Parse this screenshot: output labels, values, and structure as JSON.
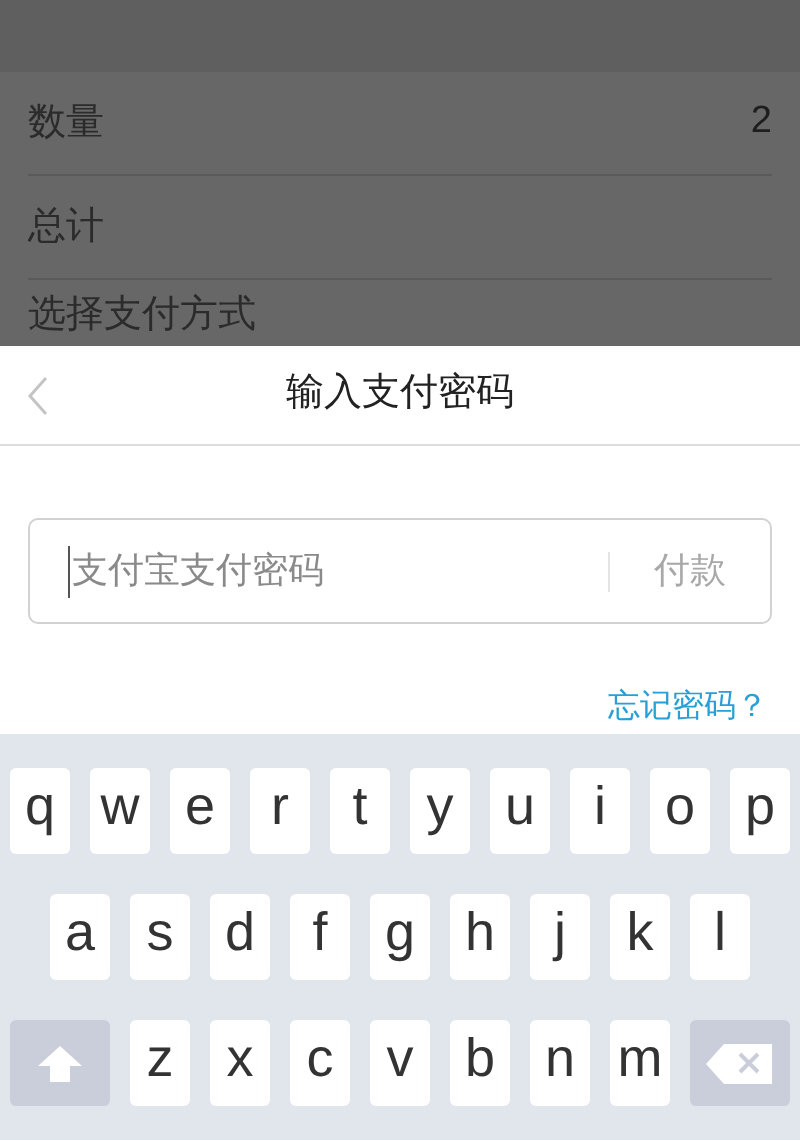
{
  "background_page": {
    "rows": [
      {
        "label": "数量",
        "value": "2"
      },
      {
        "label": "总计"
      },
      {
        "label": "选择支付方式"
      }
    ]
  },
  "sheet": {
    "title": "输入支付密码",
    "password_field": {
      "placeholder": "支付宝支付密码"
    },
    "pay_button": {
      "label": "付款",
      "disabled": true
    },
    "forgot_link": "忘记密码？"
  },
  "keyboard": {
    "rows": [
      [
        {
          "kind": "letter",
          "label": "q"
        },
        {
          "kind": "letter",
          "label": "w"
        },
        {
          "kind": "letter",
          "label": "e"
        },
        {
          "kind": "letter",
          "label": "r"
        },
        {
          "kind": "letter",
          "label": "t"
        },
        {
          "kind": "letter",
          "label": "y"
        },
        {
          "kind": "letter",
          "label": "u"
        },
        {
          "kind": "letter",
          "label": "i"
        },
        {
          "kind": "letter",
          "label": "o"
        },
        {
          "kind": "letter",
          "label": "p"
        }
      ],
      [
        {
          "kind": "letter",
          "label": "a"
        },
        {
          "kind": "letter",
          "label": "s"
        },
        {
          "kind": "letter",
          "label": "d"
        },
        {
          "kind": "letter",
          "label": "f"
        },
        {
          "kind": "letter",
          "label": "g"
        },
        {
          "kind": "letter",
          "label": "h"
        },
        {
          "kind": "letter",
          "label": "j"
        },
        {
          "kind": "letter",
          "label": "k"
        },
        {
          "kind": "letter",
          "label": "l"
        }
      ],
      [
        {
          "kind": "shift"
        },
        {
          "kind": "letter",
          "label": "z"
        },
        {
          "kind": "letter",
          "label": "x"
        },
        {
          "kind": "letter",
          "label": "c"
        },
        {
          "kind": "letter",
          "label": "v"
        },
        {
          "kind": "letter",
          "label": "b"
        },
        {
          "kind": "letter",
          "label": "n"
        },
        {
          "kind": "letter",
          "label": "m"
        },
        {
          "kind": "delete"
        }
      ]
    ]
  }
}
